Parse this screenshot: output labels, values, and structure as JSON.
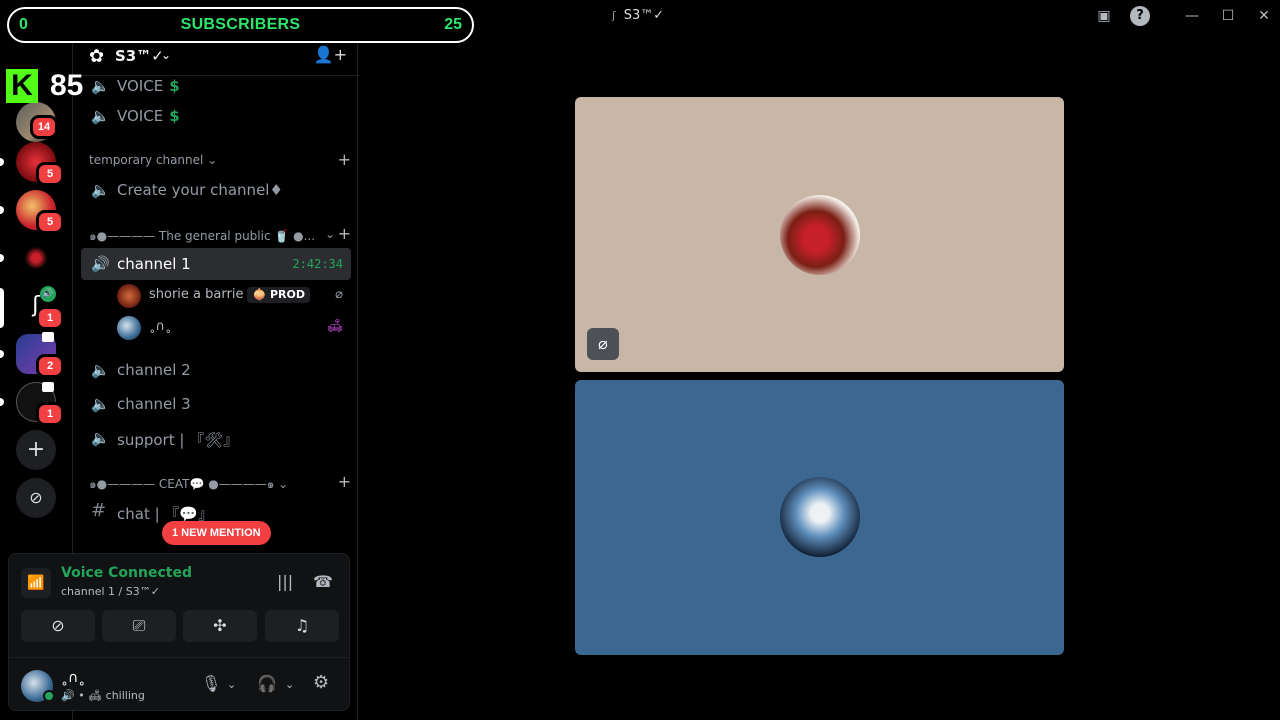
{
  "overlay": {
    "subscribers_left": "0",
    "subscribers_label": "SUBSCRIBERS",
    "subscribers_right": "25",
    "kick_logo": "K",
    "kick_count": "85"
  },
  "window": {
    "title": "S3™✓",
    "icons": [
      "inbox-icon",
      "help-icon",
      "minimize-icon",
      "maximize-icon",
      "close-icon"
    ]
  },
  "rail": {
    "badges": [
      "14",
      "5",
      "5",
      "1",
      "2",
      "1"
    ]
  },
  "guild": {
    "name": "S3™✓"
  },
  "channels": {
    "voice_top": "VOICE",
    "voice_2": "VOICE",
    "dollar": "$",
    "cat_temp": "temporary channel",
    "create": "Create your channel♦",
    "cat_public": "๑●———— The general public 🥤 ●...",
    "channel1": "channel 1",
    "channel1_timer": "2:42:34",
    "user1_name": "shorie a barrie",
    "user1_tag": "PROD",
    "user2_name": "˳∩˳",
    "channel2": "channel 2",
    "channel3": "channel 3",
    "support": "support | 『🛠』",
    "cat_ceat": "๑●———— CEAT💬 ●————๑",
    "chat": "chat | 『💬』",
    "mention": "1 NEW MENTION"
  },
  "voice_panel": {
    "title": "Voice Connected",
    "subtitle": "channel 1 / S3™✓"
  },
  "user_panel": {
    "name": "˳∩˳",
    "status": "chilling"
  },
  "colors": {
    "tile_top": "#c8b6a6",
    "tile_bottom": "#3b6791",
    "accent_green": "#23a55a",
    "mention_red": "#f23f42"
  }
}
